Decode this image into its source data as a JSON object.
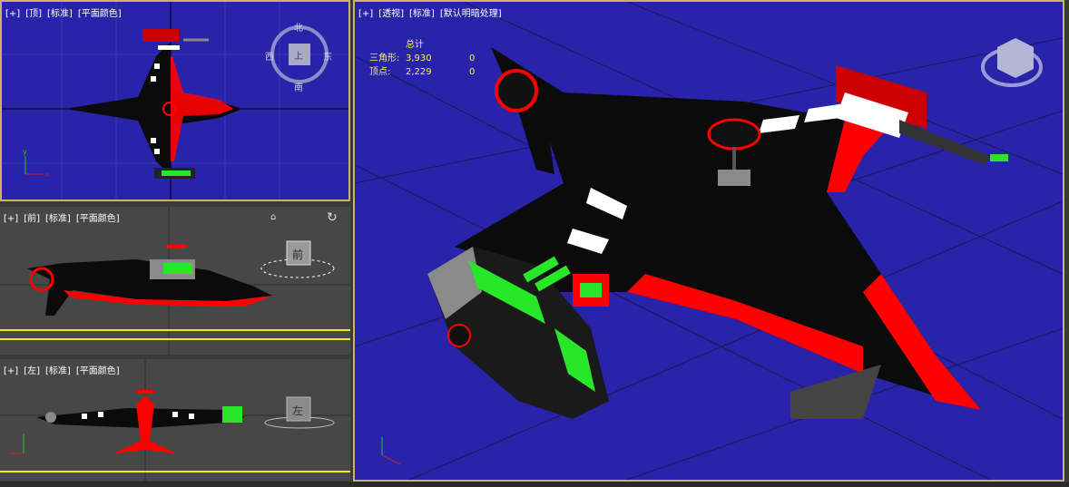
{
  "viewports": {
    "top": {
      "labels": [
        "[+]",
        "[顶]",
        "[标准]",
        "[平面颜色]"
      ],
      "compass": {
        "n": "北",
        "s": "南",
        "e": "东",
        "w": "西",
        "face": "上"
      }
    },
    "front": {
      "labels": [
        "[+]",
        "[前]",
        "[标准]",
        "[平面颜色]"
      ],
      "cube_face": "前"
    },
    "left": {
      "labels": [
        "[+]",
        "[左]",
        "[标准]",
        "[平面颜色]"
      ],
      "cube_face": "左"
    },
    "perspective": {
      "labels": [
        "[+]",
        "[透视]",
        "[标准]",
        "[默认明暗处理]"
      ]
    }
  },
  "stats": {
    "header": "总计",
    "rows": [
      {
        "label": "三角形:",
        "value": "3,930",
        "extra": "0"
      },
      {
        "label": "顶点:",
        "value": "2,229",
        "extra": "0"
      }
    ]
  },
  "colors": {
    "viewport_blue": "#2823a8",
    "viewport_gray": "#474747",
    "active_border": "#c9b36a",
    "stats_text": "#f3ee6a",
    "model_red": "#ff0000",
    "model_black": "#0b0b0b",
    "model_green": "#28e628",
    "model_gray": "#8a8a8a"
  }
}
